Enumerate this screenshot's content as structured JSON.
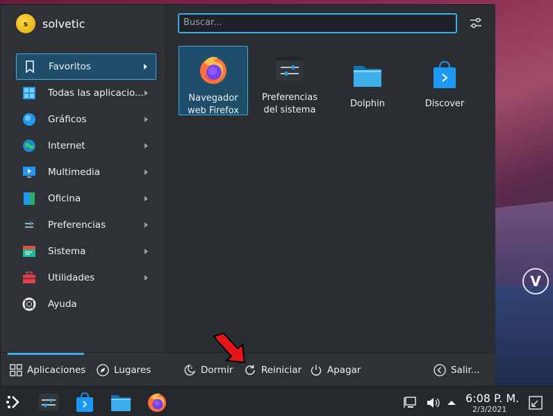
{
  "user": {
    "name": "solvetic",
    "avatar_letter": "s"
  },
  "search": {
    "placeholder": "Buscar..."
  },
  "categories": [
    {
      "label": "Favoritos",
      "icon": "bookmark-icon"
    },
    {
      "label": "Todas las aplicacio...",
      "icon": "grid-icon"
    },
    {
      "label": "Gráficos",
      "icon": "graphics-icon"
    },
    {
      "label": "Internet",
      "icon": "globe-icon"
    },
    {
      "label": "Multimedia",
      "icon": "multimedia-icon"
    },
    {
      "label": "Oficina",
      "icon": "office-icon"
    },
    {
      "label": "Preferencias",
      "icon": "sliders-icon"
    },
    {
      "label": "Sistema",
      "icon": "system-icon"
    },
    {
      "label": "Utilidades",
      "icon": "toolbox-icon"
    },
    {
      "label": "Ayuda",
      "icon": "lifebuoy-icon"
    }
  ],
  "favorites": [
    {
      "label": "Navegador web Firefox",
      "icon": "firefox-icon"
    },
    {
      "label": "Preferencias del sistema",
      "icon": "system-settings-icon"
    },
    {
      "label": "Dolphin",
      "icon": "folder-icon"
    },
    {
      "label": "Discover",
      "icon": "store-bag-icon"
    }
  ],
  "bottom": {
    "tab_apps": "Aplicaciones",
    "tab_places": "Lugares",
    "sleep": "Dormir",
    "restart": "Reiniciar",
    "shutdown": "Apagar",
    "logout": "Salir..."
  },
  "taskbar": {
    "time": "6:08 P. M.",
    "date": "2/3/2021"
  },
  "colors": {
    "accent": "#3daee9",
    "selection": "#1e4e6a",
    "panel": "#2a2e32",
    "arrow": "#e8141c"
  }
}
